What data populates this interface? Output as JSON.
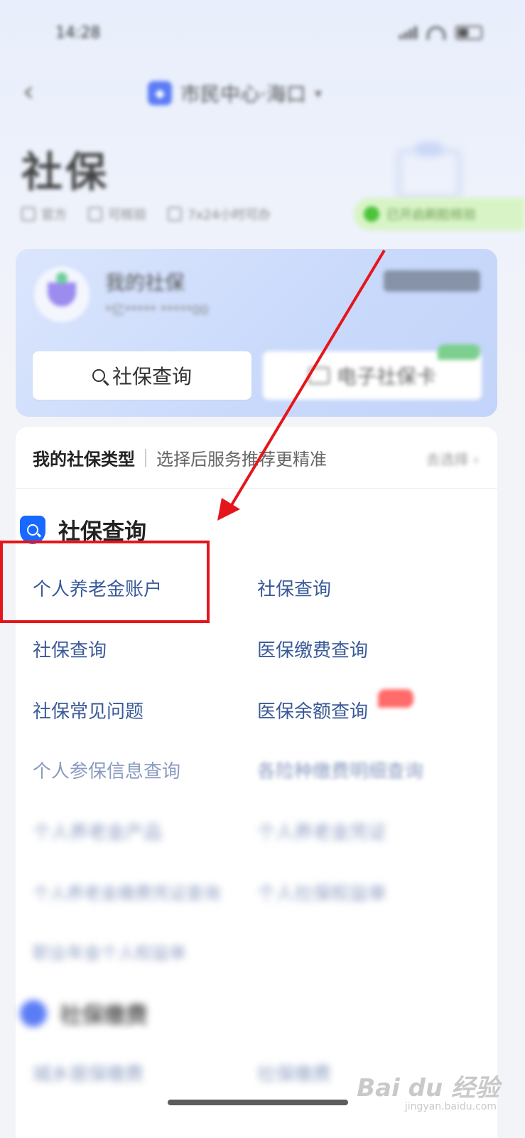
{
  "status_bar": {
    "time": "14:28"
  },
  "nav": {
    "city_label": "市民中心·海口"
  },
  "header": {
    "title": "社保",
    "tags": [
      "官方",
      "可核验",
      "7x24小时可办"
    ],
    "pill_text": "已开启刷脸核验"
  },
  "card": {
    "title": "我的社保",
    "subtitle": "*亿***** *****00",
    "query_button": "社保查询",
    "ecard_button": "电子社保卡"
  },
  "type_row": {
    "label": "我的社保类型",
    "hint": "选择后服务推荐更精准",
    "action": "去选择 ›"
  },
  "section_query": {
    "title": "社保查询",
    "items": [
      "个人养老金账户",
      "社保查询",
      "社保查询",
      "医保缴费查询",
      "社保常见问题",
      "医保余额查询",
      "个人参保信息查询",
      "各险种缴费明细查询",
      "个人养老金产品",
      "个人养老金凭证",
      "个人养老金缴费凭证查询",
      "个人社保权益单",
      "职业年金个人权益单"
    ]
  },
  "section_pay": {
    "title": "社保缴费",
    "items": [
      "城乡居保缴费",
      "社保缴费"
    ]
  },
  "watermark": {
    "main": "Bai du 经验",
    "sub": "jingyan.baidu.com"
  },
  "colors": {
    "accent": "#1769ff",
    "highlight": "#e5161b",
    "link": "#3a5a98"
  }
}
